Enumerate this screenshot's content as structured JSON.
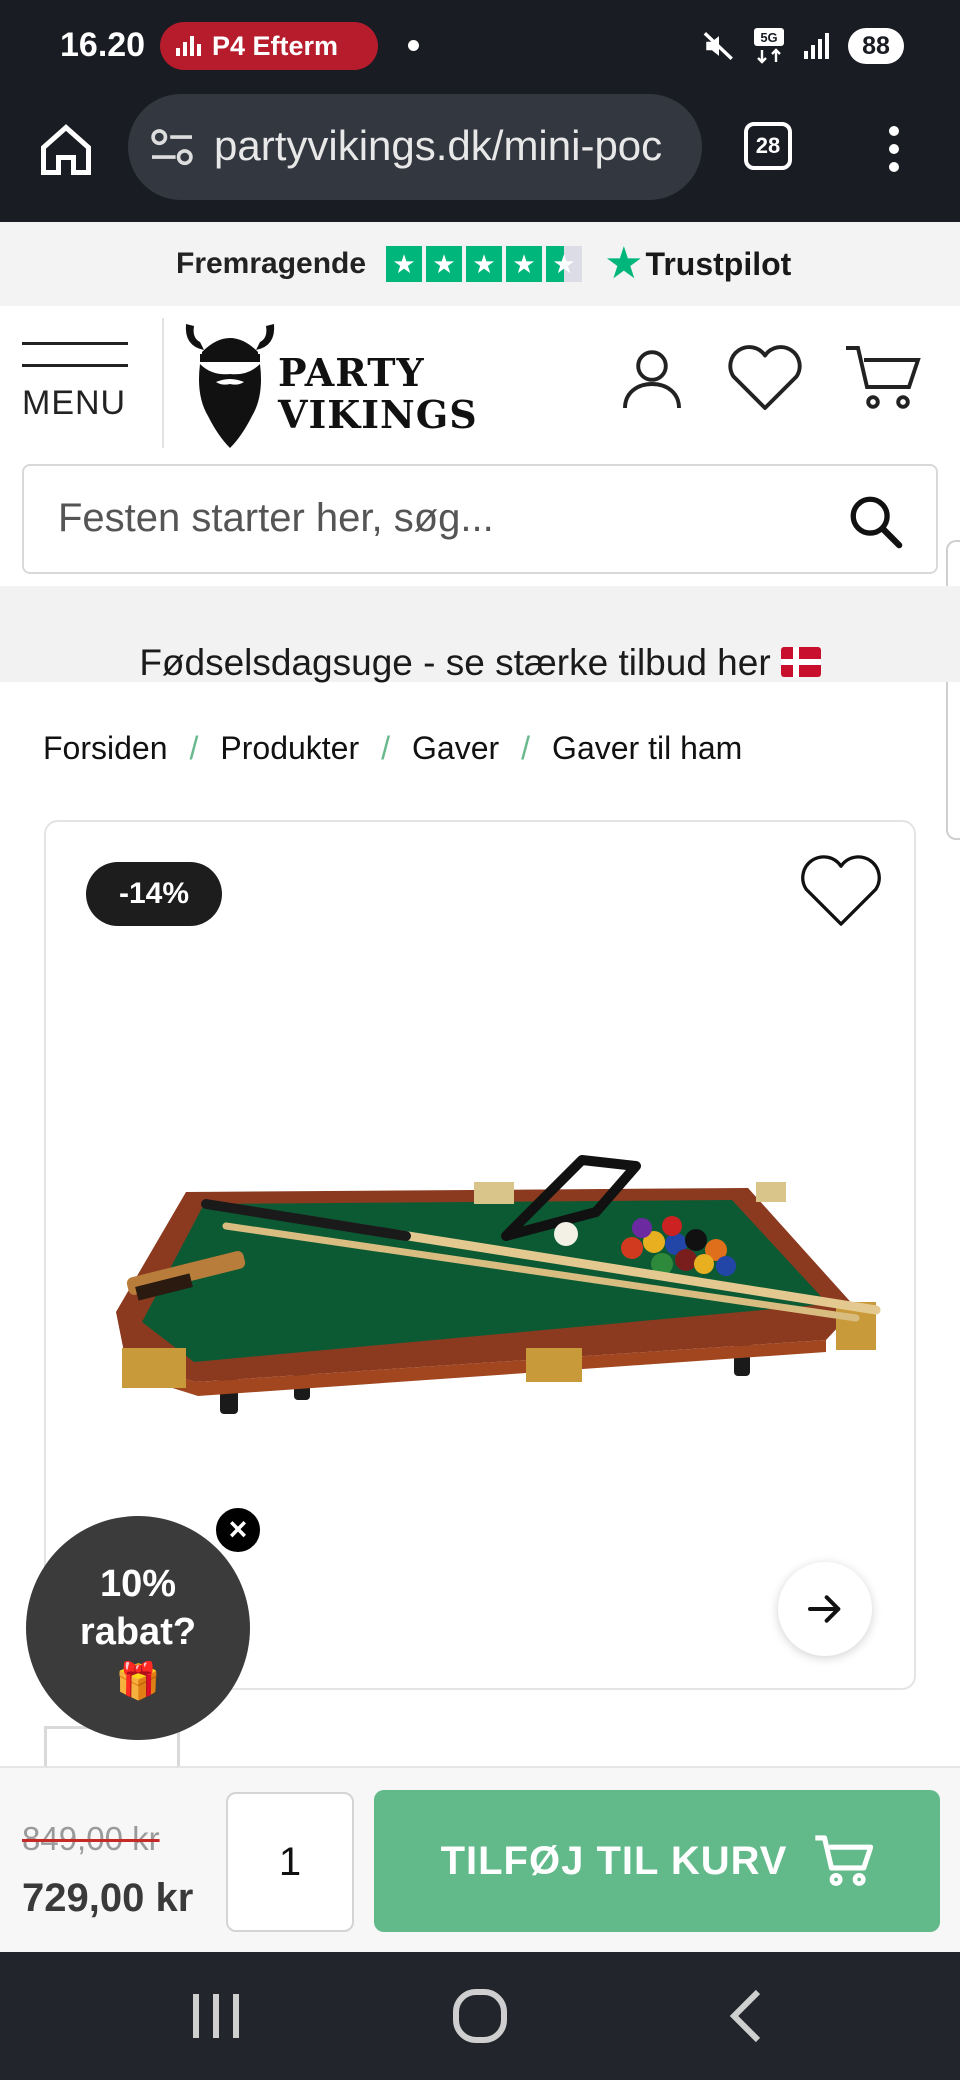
{
  "status_bar": {
    "time": "16.20",
    "media_chip": "P4 Efterm",
    "battery": "88",
    "network": "5G"
  },
  "browser": {
    "url": "partyvikings.dk/mini-poc",
    "tab_count": "28"
  },
  "trustpilot": {
    "rating_word": "Fremragende",
    "brand": "Trustpilot",
    "stars": 4.5
  },
  "header": {
    "menu_label": "MENU",
    "logo_line1": "PARTY",
    "logo_line2": "VIKINGS"
  },
  "search": {
    "placeholder": "Festen starter her, søg..."
  },
  "promo": {
    "text": "Fødselsdagsuge - se stærke tilbud her"
  },
  "breadcrumb": [
    "Forsiden",
    "Produkter",
    "Gaver",
    "Gaver til ham"
  ],
  "product": {
    "discount_badge": "-14%",
    "image_alt": "Mini pool table"
  },
  "discount_popup": {
    "line1": "10%",
    "line2": "rabat?",
    "gift": "🎁"
  },
  "buy_bar": {
    "old_price": "849,00 kr",
    "new_price": "729,00 kr",
    "quantity": "1",
    "add_to_cart": "TILFØJ TIL KURV"
  },
  "colors": {
    "accent_green": "#62b98a",
    "trustpilot_green": "#00b67a",
    "chrome_dark": "#191c22"
  }
}
